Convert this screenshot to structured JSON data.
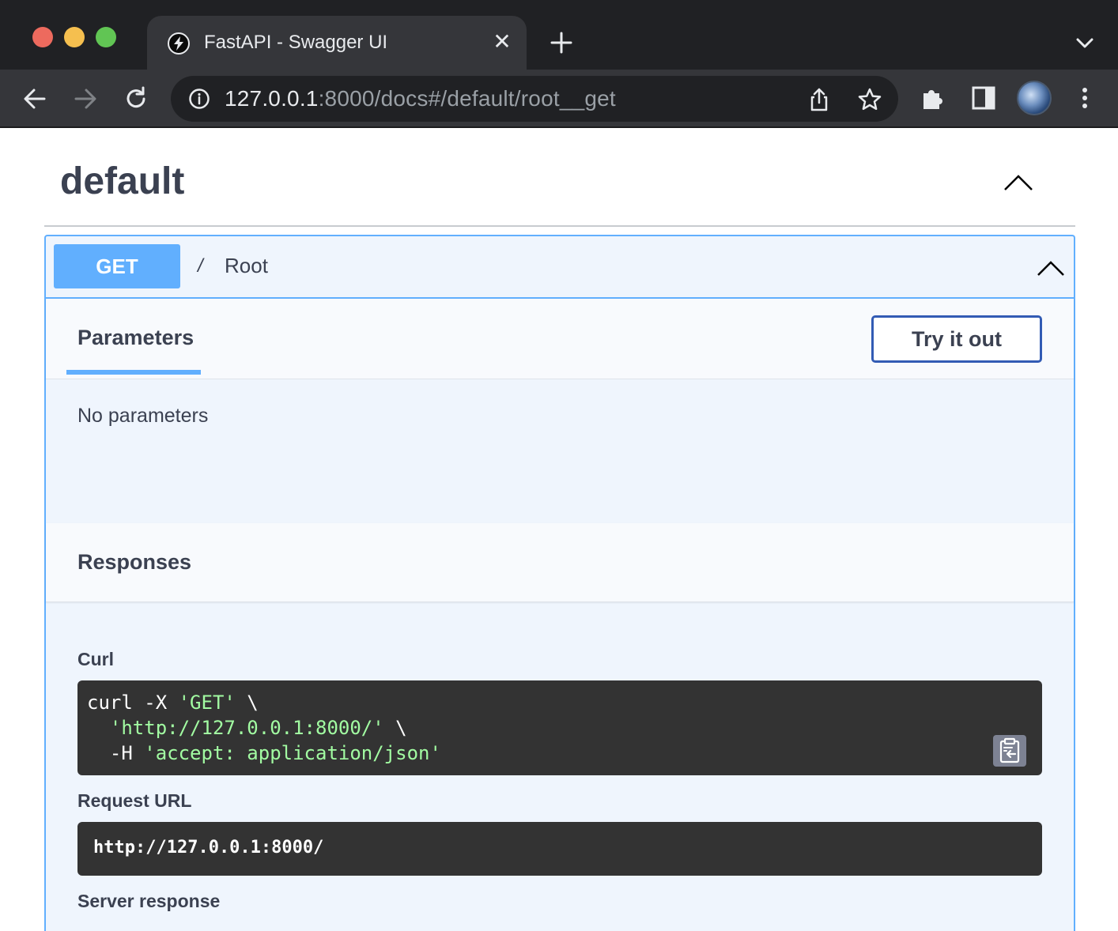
{
  "browser": {
    "tab_title": "FastAPI - Swagger UI",
    "tab_close": "✕",
    "url_host": "127.0.0.1",
    "url_rest": ":8000/docs#/default/root__get"
  },
  "section": {
    "title": "default"
  },
  "operation": {
    "method": "GET",
    "slash": "/",
    "summary": "Root",
    "parameters_tab": "Parameters",
    "try_it_out_label": "Try it out",
    "no_parameters": "No parameters",
    "responses_title": "Responses",
    "curl_label": "Curl",
    "curl_lines": [
      {
        "prefix": "curl -X ",
        "str": "'GET'",
        "suffix": " \\"
      },
      {
        "prefix": "  ",
        "str": "'http://127.0.0.1:8000/'",
        "suffix": " \\"
      },
      {
        "prefix": "  -H ",
        "str": "'accept: application/json'",
        "suffix": ""
      }
    ],
    "request_url_label": "Request URL",
    "request_url": "http://127.0.0.1:8000/",
    "server_response_label": "Server response"
  },
  "colors": {
    "get_method": "#61affe",
    "try_it_out_border": "#325bb4",
    "code_background": "#333333",
    "code_string": "#a2fca2",
    "text": "#3b4151"
  }
}
